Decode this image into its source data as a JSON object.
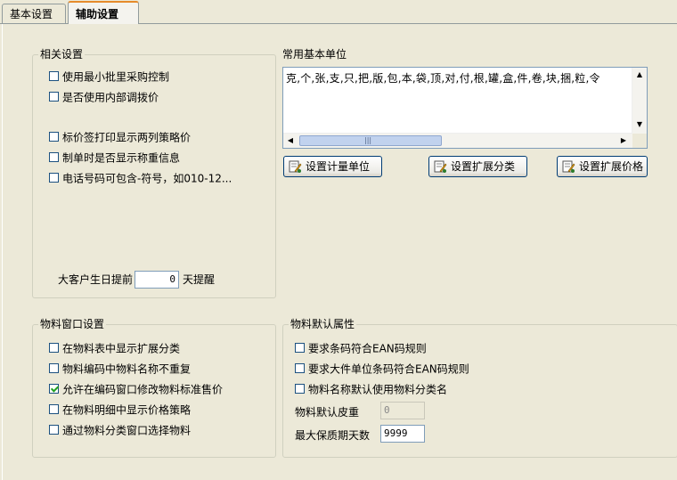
{
  "tabs": [
    {
      "label": "基本设置"
    },
    {
      "label": "辅助设置"
    }
  ],
  "related_settings": {
    "title": "相关设置",
    "items": [
      {
        "label": "使用最小批里采购控制",
        "checked": false
      },
      {
        "label": "是否使用内部调拨价",
        "checked": false
      },
      {
        "label": "标价签打印显示两列策略价",
        "checked": false
      },
      {
        "label": "制单时是否显示称重信息",
        "checked": false
      },
      {
        "label": "电话号码可包含-符号，如010-12...",
        "checked": false
      }
    ],
    "birthday_prefix": "大客户生日提前",
    "birthday_value": "0",
    "birthday_suffix": "天提醒"
  },
  "common_units": {
    "title": "常用基本单位",
    "units_text": "克,个,张,支,只,把,版,包,本,袋,顶,对,付,根,罐,盒,件,卷,块,捆,粒,令",
    "btn_unit": "设置计量单位",
    "btn_category": "设置扩展分类",
    "btn_price": "设置扩展价格"
  },
  "material_window": {
    "title": "物料窗口设置",
    "items": [
      {
        "label": "在物料表中显示扩展分类",
        "checked": false
      },
      {
        "label": "物料编码中物料名称不重复",
        "checked": false
      },
      {
        "label": "允许在编码窗口修改物料标准售价",
        "checked": true
      },
      {
        "label": "在物料明细中显示价格策略",
        "checked": false
      },
      {
        "label": "通过物料分类窗口选择物料",
        "checked": false
      }
    ]
  },
  "material_defaults": {
    "title": "物料默认属性",
    "items": [
      {
        "label": "要求条码符合EAN码规则",
        "checked": false
      },
      {
        "label": "要求大件单位条码符合EAN码规则",
        "checked": false
      },
      {
        "label": "物料名称默认使用物料分类名",
        "checked": false
      }
    ],
    "tare_label": "物料默认皮重",
    "tare_value": "0",
    "shelf_label": "最大保质期天数",
    "shelf_value": "9999"
  }
}
